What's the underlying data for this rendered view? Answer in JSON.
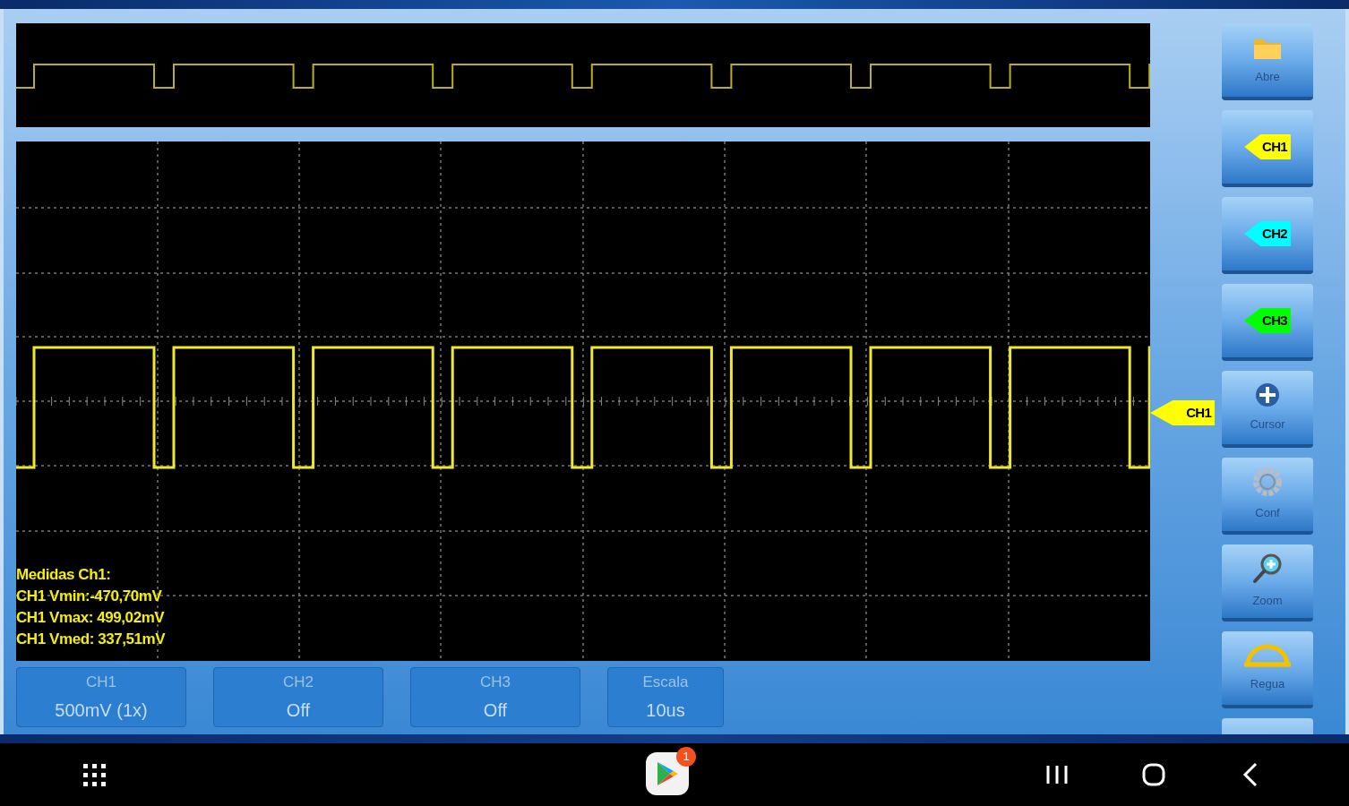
{
  "scope": {
    "measurements": {
      "title": "Medidas Ch1:",
      "lines": [
        "CH1 Vmin:-470,70mV",
        "CH1 Vmax: 499,02mV",
        "CH1 Vmed: 337,51mV"
      ]
    },
    "channel_marker": {
      "label": "CH1",
      "color": "#ffff00"
    }
  },
  "bottom_buttons": [
    {
      "title": "CH1",
      "value": "500mV (1x)"
    },
    {
      "title": "CH2",
      "value": "Off"
    },
    {
      "title": "CH3",
      "value": "Off"
    },
    {
      "title": "Escala",
      "value": "10us"
    }
  ],
  "side_buttons": [
    {
      "kind": "tool",
      "label": "Abre"
    },
    {
      "kind": "channel",
      "label": "CH1",
      "color": "#ffff00"
    },
    {
      "kind": "channel",
      "label": "CH2",
      "color": "#00ffff"
    },
    {
      "kind": "channel",
      "label": "CH3",
      "color": "#00ff00"
    },
    {
      "kind": "tool",
      "label": "Cursor"
    },
    {
      "kind": "tool",
      "label": "Conf"
    },
    {
      "kind": "tool",
      "label": "Zoom"
    },
    {
      "kind": "tool",
      "label": "Regua"
    },
    {
      "kind": "blank"
    }
  ],
  "nav_bar": {
    "badge": "1"
  }
}
